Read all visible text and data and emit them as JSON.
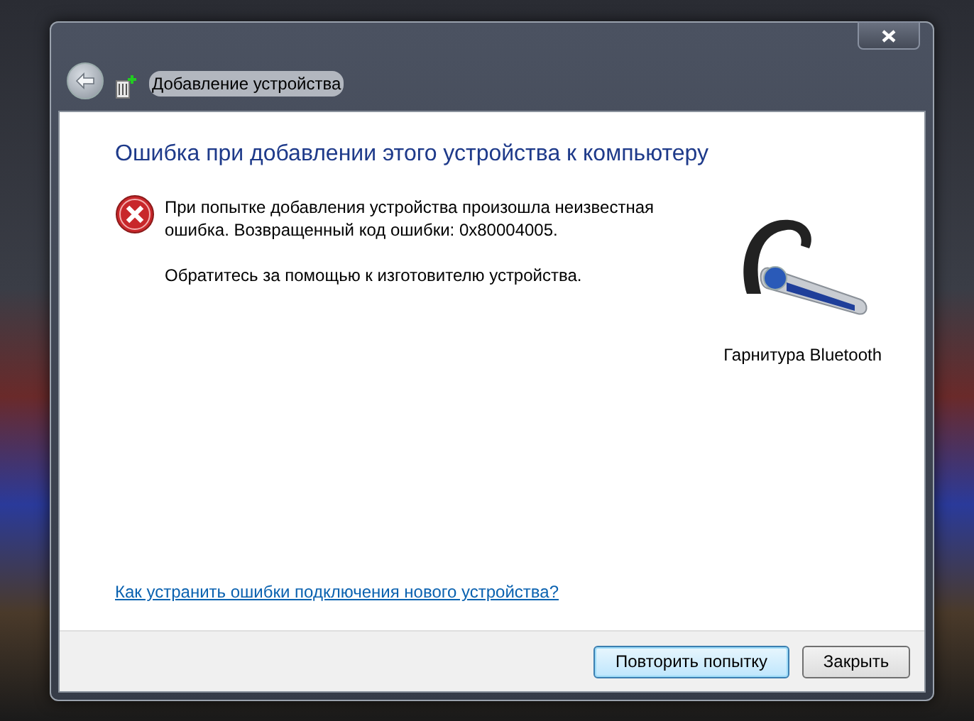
{
  "window": {
    "title": "Добавление устройства"
  },
  "heading": "Ошибка при добавлении этого устройства к компьютеру",
  "message": [
    "При попытке добавления устройства произошла неизвестная ошибка. Возвращенный код ошибки: 0x80004005.",
    "Обратитесь за помощью к изготовителю устройства."
  ],
  "device": {
    "label": "Гарнитура Bluetooth"
  },
  "help_link": "Как устранить ошибки подключения нового устройства?",
  "buttons": [
    {
      "label": "Повторить попытку",
      "default": true
    },
    {
      "label": "Закрыть",
      "default": false
    }
  ]
}
